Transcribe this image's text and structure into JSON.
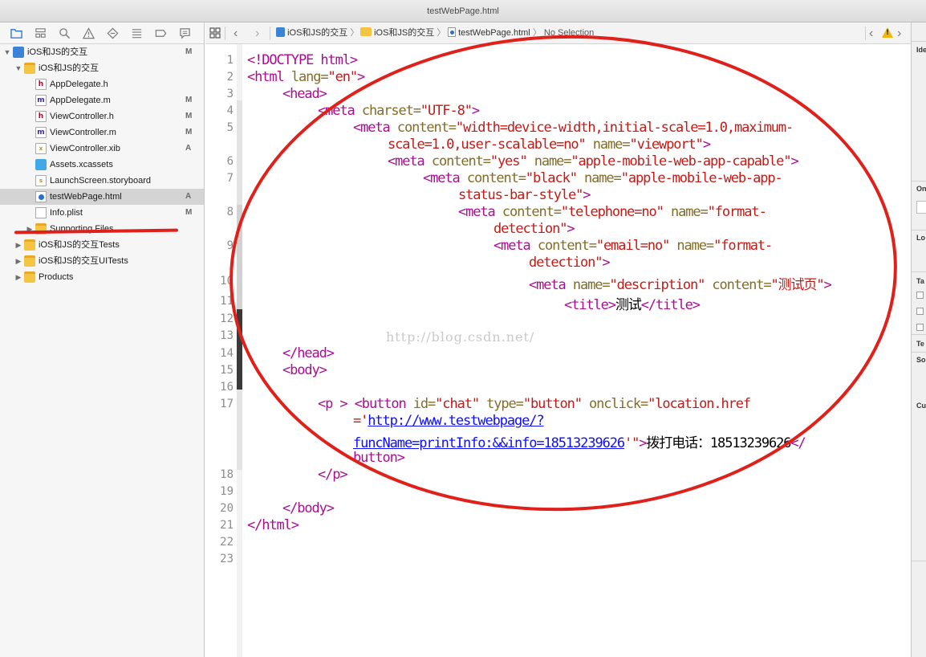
{
  "window": {
    "title": "testWebPage.html"
  },
  "navigator": {
    "toolbar_icons": [
      "folder-icon",
      "hierarchy-icon",
      "search-icon",
      "warning-icon",
      "test-icon",
      "debug-icon",
      "breakpoint-icon",
      "report-icon"
    ],
    "items": [
      {
        "name": "iOS和JS的交互",
        "status": "M",
        "kind": "project",
        "indent": 0,
        "disclosure": "▼"
      },
      {
        "name": "iOS和JS的交互",
        "status": "",
        "kind": "folder",
        "indent": 1,
        "disclosure": "▼"
      },
      {
        "name": "AppDelegate.h",
        "status": "",
        "kind": "h",
        "indent": 2,
        "disclosure": ""
      },
      {
        "name": "AppDelegate.m",
        "status": "M",
        "kind": "m",
        "indent": 2,
        "disclosure": ""
      },
      {
        "name": "ViewController.h",
        "status": "M",
        "kind": "h",
        "indent": 2,
        "disclosure": ""
      },
      {
        "name": "ViewController.m",
        "status": "M",
        "kind": "m",
        "indent": 2,
        "disclosure": ""
      },
      {
        "name": "ViewController.xib",
        "status": "A",
        "kind": "xib",
        "indent": 2,
        "disclosure": ""
      },
      {
        "name": "Assets.xcassets",
        "status": "",
        "kind": "assets",
        "indent": 2,
        "disclosure": ""
      },
      {
        "name": "LaunchScreen.storyboard",
        "status": "",
        "kind": "storyboard",
        "indent": 2,
        "disclosure": ""
      },
      {
        "name": "testWebPage.html",
        "status": "A",
        "kind": "html",
        "indent": 2,
        "disclosure": "",
        "selected": true
      },
      {
        "name": "Info.plist",
        "status": "M",
        "kind": "plist",
        "indent": 2,
        "disclosure": ""
      },
      {
        "name": "Supporting Files",
        "status": "",
        "kind": "folder",
        "indent": 2,
        "disclosure": "▶"
      },
      {
        "name": "iOS和JS的交互Tests",
        "status": "",
        "kind": "folder",
        "indent": 1,
        "disclosure": "▶"
      },
      {
        "name": "iOS和JS的交互UITests",
        "status": "",
        "kind": "folder",
        "indent": 1,
        "disclosure": "▶"
      },
      {
        "name": "Products",
        "status": "",
        "kind": "folder",
        "indent": 1,
        "disclosure": "▶"
      }
    ]
  },
  "jumpbar": {
    "grid_icon": "grid-icon",
    "back_icon": "chevron-left-icon",
    "forward_icon": "chevron-right-icon",
    "crumbs": [
      "iOS和JS的交互",
      "iOS和JS的交互",
      "testWebPage.html",
      "No Selection"
    ],
    "separator": "〉",
    "issue_prev_icon": "chevron-left-icon",
    "issue_warning_icon": "warning-icon",
    "issue_next_icon": "chevron-right-icon"
  },
  "editor": {
    "line_numbers": [
      "1",
      "2",
      "3",
      "4",
      "5",
      "",
      "6",
      "7",
      "",
      "8",
      "",
      "9",
      "",
      "10",
      "11",
      "12",
      "13",
      "14",
      "15",
      "16",
      "17",
      "",
      "",
      "",
      "18",
      "19",
      "20",
      "21",
      "22",
      "23"
    ],
    "lines": [
      [
        [
          "tag",
          "<!DOCTYPE html>"
        ]
      ],
      [
        [
          "tag",
          "<html "
        ],
        [
          "attr",
          "lang="
        ],
        [
          "str",
          "\"en\""
        ],
        [
          "tag",
          ">"
        ]
      ],
      [
        [
          "tag",
          "<head>"
        ]
      ],
      [
        [
          "tag",
          "<meta "
        ],
        [
          "attr",
          "charset="
        ],
        [
          "str",
          "\"UTF-8\""
        ],
        [
          "tag",
          ">"
        ]
      ],
      [
        [
          "tag",
          "<meta "
        ],
        [
          "attr",
          "content="
        ],
        [
          "str",
          "\"width=device-width,initial-scale=1.0,maximum-"
        ]
      ],
      [
        [
          "str",
          "scale=1.0,user-scalable=no\" "
        ],
        [
          "attr",
          "name="
        ],
        [
          "str",
          "\"viewport\""
        ],
        [
          "tag",
          ">"
        ]
      ],
      [
        [
          "tag",
          "<meta "
        ],
        [
          "attr",
          "content="
        ],
        [
          "str",
          "\"yes\" "
        ],
        [
          "attr",
          "name="
        ],
        [
          "str",
          "\"apple-mobile-web-app-capable\""
        ],
        [
          "tag",
          ">"
        ]
      ],
      [
        [
          "tag",
          "<meta "
        ],
        [
          "attr",
          "content="
        ],
        [
          "str",
          "\"black\" "
        ],
        [
          "attr",
          "name="
        ],
        [
          "str",
          "\"apple-mobile-web-app-"
        ]
      ],
      [
        [
          "str",
          "status-bar-style\""
        ],
        [
          "tag",
          ">"
        ]
      ],
      [
        [
          "tag",
          "<meta "
        ],
        [
          "attr",
          "content="
        ],
        [
          "str",
          "\"telephone=no\" "
        ],
        [
          "attr",
          "name="
        ],
        [
          "str",
          "\"format-"
        ]
      ],
      [
        [
          "str",
          "detection\""
        ],
        [
          "tag",
          ">"
        ]
      ],
      [
        [
          "tag",
          "<meta "
        ],
        [
          "attr",
          "content="
        ],
        [
          "str",
          "\"email=no\" "
        ],
        [
          "attr",
          "name="
        ],
        [
          "str",
          "\"format-"
        ]
      ],
      [
        [
          "str",
          "detection\""
        ],
        [
          "tag",
          ">"
        ]
      ],
      [
        [
          "tag",
          "<meta "
        ],
        [
          "attr",
          "name="
        ],
        [
          "str",
          "\"description\" "
        ],
        [
          "attr",
          "content="
        ],
        [
          "str",
          "\"测试页\""
        ],
        [
          "tag",
          ">"
        ]
      ],
      [
        [
          "tag",
          "<title>"
        ],
        [
          "txt",
          "测试"
        ],
        [
          "tag",
          "</title>"
        ]
      ],
      [],
      [],
      [
        [
          "tag",
          "</head>"
        ]
      ],
      [
        [
          "tag",
          "<body>"
        ]
      ],
      [],
      [
        [
          "tag",
          "<p > <button "
        ],
        [
          "attr",
          "id="
        ],
        [
          "str",
          "\"chat\" "
        ],
        [
          "attr",
          "type="
        ],
        [
          "str",
          "\"button\" "
        ],
        [
          "attr",
          "onclick="
        ],
        [
          "str",
          "\"location.href"
        ]
      ],
      [
        [
          "str",
          "='"
        ],
        [
          "url",
          "http://www.testwebpage/?"
        ]
      ],
      [
        [
          "url",
          "funcName=printInfo:&&info=18513239626"
        ],
        [
          "str",
          "'\""
        ],
        [
          "tag",
          ">"
        ],
        [
          "txt",
          "拨打电话：18513239626"
        ],
        [
          "tag",
          "</"
        ]
      ],
      [
        [
          "tag",
          "button>"
        ]
      ],
      [
        [
          "tag",
          "</p>"
        ]
      ],
      [],
      [
        [
          "tag",
          "</body>"
        ]
      ],
      [
        [
          "tag",
          "</html>"
        ]
      ],
      [],
      []
    ]
  },
  "watermark": "http://blog.csdn.net/",
  "annotation_color": "#e0201a",
  "inspector": {
    "labels": [
      "Ide",
      "On",
      "Lo",
      "Ta",
      "Te",
      "So",
      "Cu"
    ]
  }
}
